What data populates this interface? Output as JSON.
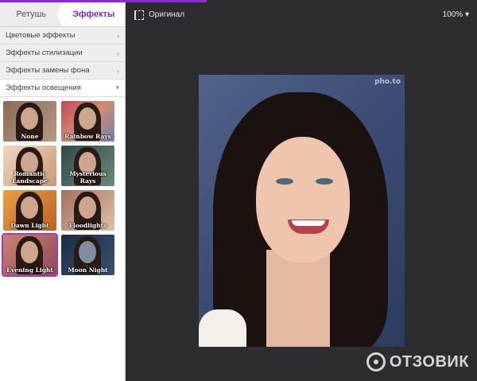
{
  "tabs": [
    {
      "label": "Ретушь"
    },
    {
      "label": "Эффекты"
    }
  ],
  "accordion": [
    {
      "label": "Цветовые эффекты"
    },
    {
      "label": "Эффекты стилизации"
    },
    {
      "label": "Эффекты замены фона"
    },
    {
      "label": "Эффекты освещения"
    }
  ],
  "effects": [
    {
      "label": "None"
    },
    {
      "label": "Rainbow Rays"
    },
    {
      "label": "Romantic Landscape"
    },
    {
      "label": "Mysterious Rays"
    },
    {
      "label": "Dawn Light"
    },
    {
      "label": "Floodlights"
    },
    {
      "label": "Evening Light"
    },
    {
      "label": "Moon Night"
    }
  ],
  "toolbar": {
    "original_label": "Оригинал",
    "zoom": "100%"
  },
  "photo": {
    "watermark": "pho.to"
  },
  "brand": {
    "name": "ОТЗОВИК"
  }
}
